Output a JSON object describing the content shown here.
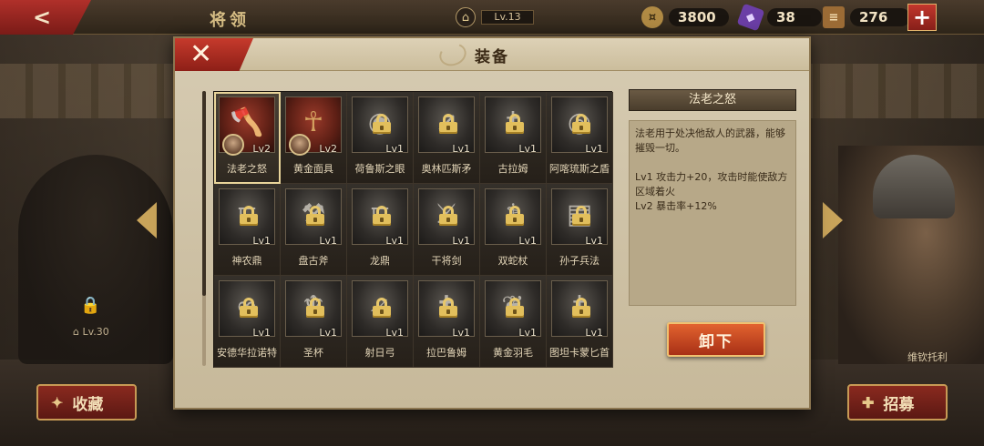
{
  "topbar": {
    "back_icon": "back-arrow-icon",
    "title": "将领",
    "level_badge": "Lv.13",
    "resources": [
      {
        "name": "gold",
        "icon": "gold-coin-icon",
        "value": "3800"
      },
      {
        "name": "gem",
        "icon": "purple-gem-icon",
        "value": "38"
      },
      {
        "name": "scroll",
        "icon": "scroll-icon",
        "value": "276"
      }
    ],
    "plus_label": "+"
  },
  "background": {
    "locked_level": "Lv.30",
    "right_hero_label": "维钦托利"
  },
  "bottom": {
    "collect_label": "收藏",
    "recruit_label": "招募"
  },
  "modal": {
    "title": "装备",
    "close_label": "✕",
    "items": [
      {
        "name": "法老之怒",
        "level": "Lv2",
        "locked": false,
        "equipped": true,
        "selected": true,
        "icon": "axe-icon",
        "glyph": "🪓",
        "red": true
      },
      {
        "name": "黄金面具",
        "level": "Lv2",
        "locked": false,
        "equipped": true,
        "selected": false,
        "icon": "mask-icon",
        "glyph": "☥",
        "red": true
      },
      {
        "name": "荷鲁斯之眼",
        "level": "Lv1",
        "locked": true,
        "icon": "eye-bracelet-icon",
        "glyph": "◉"
      },
      {
        "name": "奥林匹斯矛",
        "level": "Lv1",
        "locked": true,
        "icon": "spear-icon",
        "glyph": "↗"
      },
      {
        "name": "古拉姆",
        "level": "Lv1",
        "locked": true,
        "icon": "sword-icon",
        "glyph": "†"
      },
      {
        "name": "阿喀琉斯之盾",
        "level": "Lv1",
        "locked": true,
        "icon": "helmet-icon",
        "glyph": "◎"
      },
      {
        "name": "神农鼎",
        "level": "Lv1",
        "locked": true,
        "icon": "cauldron-icon",
        "glyph": "⩌"
      },
      {
        "name": "盘古斧",
        "level": "Lv1",
        "locked": true,
        "icon": "axe-icon",
        "glyph": "⚒"
      },
      {
        "name": "龙鼎",
        "level": "Lv1",
        "locked": true,
        "icon": "cauldron-icon",
        "glyph": "⩌"
      },
      {
        "name": "干将剑",
        "level": "Lv1",
        "locked": true,
        "icon": "sword-icon",
        "glyph": "⚔"
      },
      {
        "name": "双蛇杖",
        "level": "Lv1",
        "locked": true,
        "icon": "caduceus-icon",
        "glyph": "⚕"
      },
      {
        "name": "孙子兵法",
        "level": "Lv1",
        "locked": true,
        "icon": "scroll-book-icon",
        "glyph": "▤"
      },
      {
        "name": "安德华拉诺特",
        "level": "Lv1",
        "locked": true,
        "icon": "serpent-ring-icon",
        "glyph": "∞"
      },
      {
        "name": "圣杯",
        "level": "Lv1",
        "locked": true,
        "icon": "grail-icon",
        "glyph": "♆"
      },
      {
        "name": "射日弓",
        "level": "Lv1",
        "locked": true,
        "icon": "bow-icon",
        "glyph": "➶"
      },
      {
        "name": "拉巴鲁姆",
        "level": "Lv1",
        "locked": true,
        "icon": "spear-icon",
        "glyph": "✝"
      },
      {
        "name": "黄金羽毛",
        "level": "Lv1",
        "locked": true,
        "icon": "wing-icon",
        "glyph": "❦"
      },
      {
        "name": "图坦卡蒙匕首",
        "level": "Lv1",
        "locked": true,
        "icon": "dagger-icon",
        "glyph": "†"
      }
    ],
    "detail": {
      "title": "法老之怒",
      "description": "法老用于处决他敌人的武器，能够摧毁一切。",
      "effects": [
        "Lv1  攻击力+20，攻击时能使敌方区域着火",
        "Lv2  暴击率+12%"
      ]
    },
    "unequip_label": "卸下"
  }
}
